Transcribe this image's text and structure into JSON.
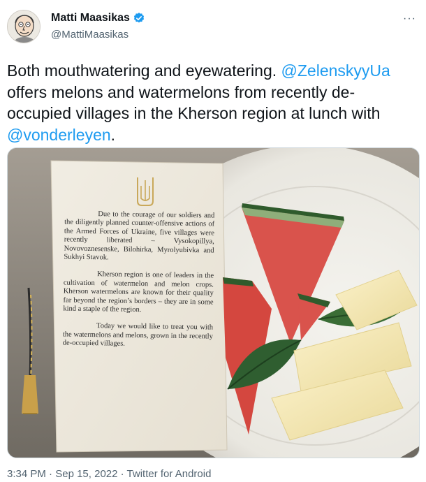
{
  "author": {
    "name": "Matti Maasikas",
    "handle": "@MattiMaasikas",
    "avatar_icon": "caricature-avatar",
    "verified_icon": "verified-badge-icon",
    "verified_color": "#1d9bf0"
  },
  "more_icon": "ellipsis-icon",
  "more_label": "···",
  "tweet": {
    "part1": "Both mouthwatering and eyewatering. ",
    "mention1": "@ZelenskyyUa",
    "part2": " offers melons and watermelons from recently de-occupied villages in the Kherson region at lunch with ",
    "mention2": "@vonderleyen",
    "part3": "."
  },
  "card": {
    "paragraph1": "Due to the courage of our soldiers and the diligently planned counter-offensive actions of the Armed Forces of Ukraine, five villages were recently liberated – Vysokopillya, Novovoznesenske, Bilohirka, Myrolyubivka and Sukhyi Stavok.",
    "paragraph2": "Kherson region is one of leaders in the cultivation of watermelon and melon crops. Kherson watermelons are known for their quality far beyond the region’s borders – they are in some kind a staple of the region.",
    "paragraph3": "Today we would like to treat you with the watermelons and melons, grown in the recently de-occupied villages."
  },
  "footer": {
    "time": "3:34 PM",
    "sep1": " · ",
    "date": "Sep 15, 2022",
    "sep2": " · ",
    "source": "Twitter for Android"
  },
  "colors": {
    "mention": "#1d9bf0",
    "secondary_text": "#536471"
  }
}
